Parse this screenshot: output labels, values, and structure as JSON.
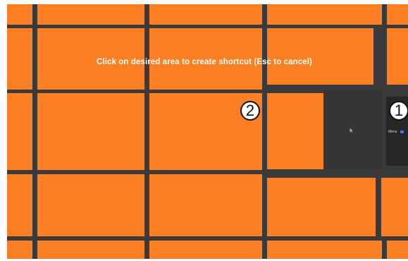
{
  "overlay": {
    "instruction": "Click on desired area to create shortcut (Esc to cancel)"
  },
  "badges": [
    "2",
    "1"
  ],
  "window_thumbnail": {
    "label": "Menu"
  },
  "colors": {
    "tile": "#fd7f23",
    "grid_gap": "#3a3a3a",
    "dark_window": "#353535",
    "badge_bg": "#ffffff",
    "badge_border": "#111111"
  },
  "icons": {
    "cursor": "mouse-pointer-icon"
  }
}
